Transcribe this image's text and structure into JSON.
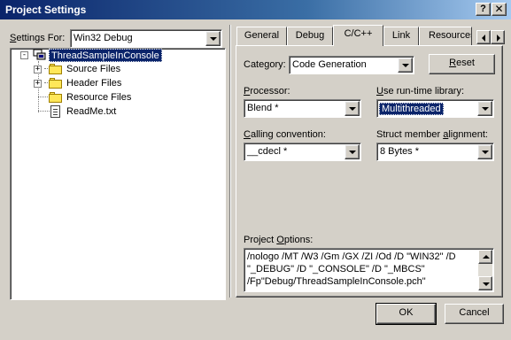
{
  "window": {
    "title": "Project Settings",
    "help_btn": "?",
    "close_btn": "x"
  },
  "settings_for": {
    "label_pre": "S",
    "label_rest": "ettings For:",
    "value": "Win32 Debug"
  },
  "tree": {
    "project": "ThreadSampleInConsole",
    "expand_project": "-",
    "items": [
      {
        "label": "Source Files",
        "type": "folder",
        "expand": "+"
      },
      {
        "label": "Header Files",
        "type": "folder",
        "expand": "+"
      },
      {
        "label": "Resource Files",
        "type": "folder",
        "expand": ""
      },
      {
        "label": "ReadMe.txt",
        "type": "file",
        "expand": ""
      }
    ]
  },
  "tabs": [
    "General",
    "Debug",
    "C/C++",
    "Link",
    "Resources"
  ],
  "active_tab": "C/C++",
  "category": {
    "label_pre": "Cate",
    "label_u": "g",
    "label_rest": "ory:",
    "value": "Code Generation"
  },
  "reset_button": {
    "pre": "",
    "u": "R",
    "rest": "eset"
  },
  "processor": {
    "label_pre": "",
    "label_u": "P",
    "label_rest": "rocessor:",
    "value": "Blend *"
  },
  "runtime_library": {
    "label_pre": "",
    "label_u": "U",
    "label_rest": "se run-time library:",
    "value": "Multithreaded"
  },
  "calling_convention": {
    "label_pre": "",
    "label_u": "C",
    "label_rest": "alling convention:",
    "value": "__cdecl *"
  },
  "struct_alignment": {
    "label_pre": "Struct member ",
    "label_u": "a",
    "label_rest": "lignment:",
    "value": "8 Bytes *"
  },
  "project_options": {
    "label_pre": "Project ",
    "label_u": "O",
    "label_rest": "ptions:",
    "lines": [
      "/nologo /MT /W3 /Gm /GX /ZI /Od /D \"WIN32\" /D",
      "\"_DEBUG\" /D \"_CONSOLE\" /D \"_MBCS\"",
      "/Fp\"Debug/ThreadSampleInConsole.pch\""
    ]
  },
  "buttons": {
    "ok": "OK",
    "cancel": "Cancel"
  },
  "colors": {
    "title_start": "#0a246a",
    "title_end": "#a6caf0",
    "face": "#d4d0c8",
    "selection": "#0a246a"
  }
}
